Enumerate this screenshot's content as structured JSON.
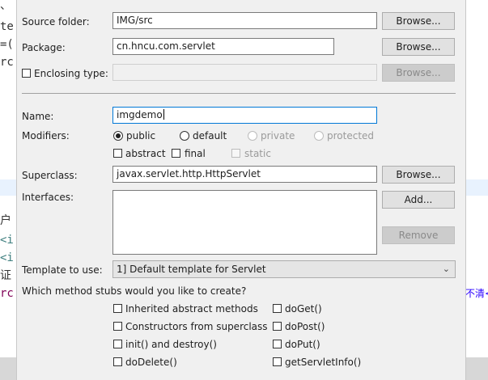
{
  "background_editor": {
    "left_lines": [
      "、",
      "te",
      "=(",
      "rc",
      "户",
      "<i",
      "<i",
      "证",
      "rc"
    ],
    "right_text": "不清<"
  },
  "form": {
    "source_folder": {
      "label": "Source folder:",
      "value": "IMG/src",
      "browse": "Browse..."
    },
    "package": {
      "label": "Package:",
      "value": "cn.hncu.com.servlet",
      "browse": "Browse..."
    },
    "enclosing_type": {
      "label": "Enclosing type:",
      "value": "",
      "browse": "Browse...",
      "checked": false
    },
    "name": {
      "label": "Name:",
      "value": "imgdemo"
    },
    "modifiers": {
      "label": "Modifiers:",
      "public": "public",
      "default": "default",
      "private": "private",
      "protected": "protected",
      "abstract": "abstract",
      "final": "final",
      "static": "static",
      "selected": "public"
    },
    "superclass": {
      "label": "Superclass:",
      "value": "javax.servlet.http.HttpServlet",
      "browse": "Browse..."
    },
    "interfaces": {
      "label": "Interfaces:",
      "add": "Add...",
      "remove": "Remove"
    },
    "template": {
      "label": "Template to use:",
      "value": "1] Default template for Servlet"
    },
    "stubs": {
      "question": "Which method stubs would you like to create?",
      "inherited": "Inherited abstract methods",
      "constructors": "Constructors from superclass",
      "init_destroy": "init() and destroy()",
      "do_delete": "doDelete()",
      "do_get": "doGet()",
      "do_post": "doPost()",
      "do_put": "doPut()",
      "get_servlet_info": "getServletInfo()"
    }
  }
}
